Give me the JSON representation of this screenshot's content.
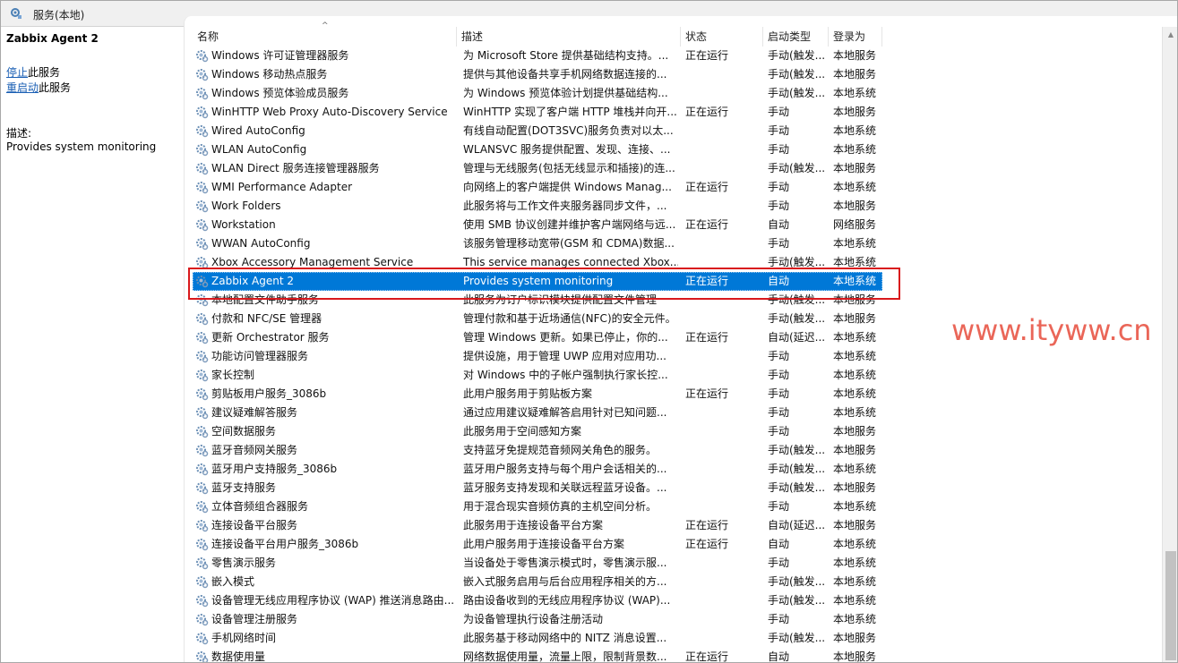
{
  "window": {
    "title": "服务(本地)"
  },
  "left_panel": {
    "service_name": "Zabbix Agent 2",
    "actions": [
      {
        "link": "停止",
        "suffix": "此服务"
      },
      {
        "link": "重启动",
        "suffix": "此服务"
      }
    ],
    "description_label": "描述:",
    "description_text": "Provides system monitoring"
  },
  "columns": {
    "name": "名称",
    "description": "描述",
    "status": "状态",
    "startup": "启动类型",
    "logon": "登录为"
  },
  "services": [
    {
      "name": "Windows 许可证管理器服务",
      "desc": "为 Microsoft Store 提供基础结构支持。...",
      "status": "正在运行",
      "startup": "手动(触发...",
      "logon": "本地服务"
    },
    {
      "name": "Windows 移动热点服务",
      "desc": "提供与其他设备共享手机网络数据连接的...",
      "status": "",
      "startup": "手动(触发...",
      "logon": "本地服务"
    },
    {
      "name": "Windows 预览体验成员服务",
      "desc": "为 Windows 预览体验计划提供基础结构...",
      "status": "",
      "startup": "手动(触发...",
      "logon": "本地系统"
    },
    {
      "name": "WinHTTP Web Proxy Auto-Discovery Service",
      "desc": "WinHTTP 实现了客户端 HTTP 堆栈并向开...",
      "status": "正在运行",
      "startup": "手动",
      "logon": "本地服务"
    },
    {
      "name": "Wired AutoConfig",
      "desc": "有线自动配置(DOT3SVC)服务负责对以太...",
      "status": "",
      "startup": "手动",
      "logon": "本地系统"
    },
    {
      "name": "WLAN AutoConfig",
      "desc": "WLANSVC 服务提供配置、发现、连接、...",
      "status": "",
      "startup": "手动",
      "logon": "本地系统"
    },
    {
      "name": "WLAN Direct 服务连接管理器服务",
      "desc": "管理与无线服务(包括无线显示和插接)的连...",
      "status": "",
      "startup": "手动(触发...",
      "logon": "本地服务"
    },
    {
      "name": "WMI Performance Adapter",
      "desc": "向网络上的客户端提供 Windows Manag...",
      "status": "正在运行",
      "startup": "手动",
      "logon": "本地系统"
    },
    {
      "name": "Work Folders",
      "desc": "此服务将与工作文件夹服务器同步文件，...",
      "status": "",
      "startup": "手动",
      "logon": "本地服务"
    },
    {
      "name": "Workstation",
      "desc": "使用 SMB 协议创建并维护客户端网络与远...",
      "status": "正在运行",
      "startup": "自动",
      "logon": "网络服务"
    },
    {
      "name": "WWAN AutoConfig",
      "desc": "该服务管理移动宽带(GSM 和 CDMA)数据...",
      "status": "",
      "startup": "手动",
      "logon": "本地系统"
    },
    {
      "name": "Xbox Accessory Management Service",
      "desc": "This service manages connected Xbox...",
      "status": "",
      "startup": "手动(触发...",
      "logon": "本地系统"
    },
    {
      "name": "Zabbix Agent 2",
      "desc": "Provides system monitoring",
      "status": "正在运行",
      "startup": "自动",
      "logon": "本地系统"
    },
    {
      "name": "本地配置文件助手服务",
      "desc": "此服务为订户标识模块提供配置文件管理",
      "status": "",
      "startup": "手动(触发...",
      "logon": "本地服务"
    },
    {
      "name": "付款和 NFC/SE 管理器",
      "desc": "管理付款和基于近场通信(NFC)的安全元件。",
      "status": "",
      "startup": "手动(触发...",
      "logon": "本地服务"
    },
    {
      "name": "更新 Orchestrator 服务",
      "desc": "管理 Windows 更新。如果已停止，你的...",
      "status": "正在运行",
      "startup": "自动(延迟...",
      "logon": "本地系统"
    },
    {
      "name": "功能访问管理器服务",
      "desc": "提供设施，用于管理 UWP 应用对应用功...",
      "status": "",
      "startup": "手动",
      "logon": "本地系统"
    },
    {
      "name": "家长控制",
      "desc": "对 Windows 中的子帐户强制执行家长控...",
      "status": "",
      "startup": "手动",
      "logon": "本地系统"
    },
    {
      "name": "剪贴板用户服务_3086b",
      "desc": "此用户服务用于剪贴板方案",
      "status": "正在运行",
      "startup": "手动",
      "logon": "本地系统"
    },
    {
      "name": "建议疑难解答服务",
      "desc": "通过应用建议疑难解答启用针对已知问题...",
      "status": "",
      "startup": "手动",
      "logon": "本地系统"
    },
    {
      "name": "空间数据服务",
      "desc": "此服务用于空间感知方案",
      "status": "",
      "startup": "手动",
      "logon": "本地服务"
    },
    {
      "name": "蓝牙音频网关服务",
      "desc": "支持蓝牙免提规范音频网关角色的服务。",
      "status": "",
      "startup": "手动(触发...",
      "logon": "本地服务"
    },
    {
      "name": "蓝牙用户支持服务_3086b",
      "desc": "蓝牙用户服务支持与每个用户会话相关的...",
      "status": "",
      "startup": "手动(触发...",
      "logon": "本地系统"
    },
    {
      "name": "蓝牙支持服务",
      "desc": "蓝牙服务支持发现和关联远程蓝牙设备。...",
      "status": "",
      "startup": "手动(触发...",
      "logon": "本地服务"
    },
    {
      "name": "立体音频组合器服务",
      "desc": "用于混合现实音频仿真的主机空间分析。",
      "status": "",
      "startup": "手动",
      "logon": "本地系统"
    },
    {
      "name": "连接设备平台服务",
      "desc": "此服务用于连接设备平台方案",
      "status": "正在运行",
      "startup": "自动(延迟...",
      "logon": "本地服务"
    },
    {
      "name": "连接设备平台用户服务_3086b",
      "desc": "此用户服务用于连接设备平台方案",
      "status": "正在运行",
      "startup": "自动",
      "logon": "本地系统"
    },
    {
      "name": "零售演示服务",
      "desc": "当设备处于零售演示模式时，零售演示服...",
      "status": "",
      "startup": "手动",
      "logon": "本地系统"
    },
    {
      "name": "嵌入模式",
      "desc": "嵌入式服务启用与后台应用程序相关的方...",
      "status": "",
      "startup": "手动(触发...",
      "logon": "本地系统"
    },
    {
      "name": "设备管理无线应用程序协议 (WAP) 推送消息路由...",
      "desc": "路由设备收到的无线应用程序协议 (WAP)...",
      "status": "",
      "startup": "手动(触发...",
      "logon": "本地系统"
    },
    {
      "name": "设备管理注册服务",
      "desc": "为设备管理执行设备注册活动",
      "status": "",
      "startup": "手动",
      "logon": "本地系统"
    },
    {
      "name": "手机网络时间",
      "desc": "此服务基于移动网络中的 NITZ 消息设置...",
      "status": "",
      "startup": "手动(触发...",
      "logon": "本地服务"
    },
    {
      "name": "数据使用量",
      "desc": "网络数据使用量，流量上限，限制背景数...",
      "status": "正在运行",
      "startup": "自动",
      "logon": "本地服务"
    }
  ],
  "selected_index": 12,
  "watermark": "www.ityww.cn",
  "colors": {
    "selection": "#0078d7",
    "highlight_box": "#d9191c",
    "watermark": "#e74c3c",
    "link": "#1a5fb4"
  }
}
